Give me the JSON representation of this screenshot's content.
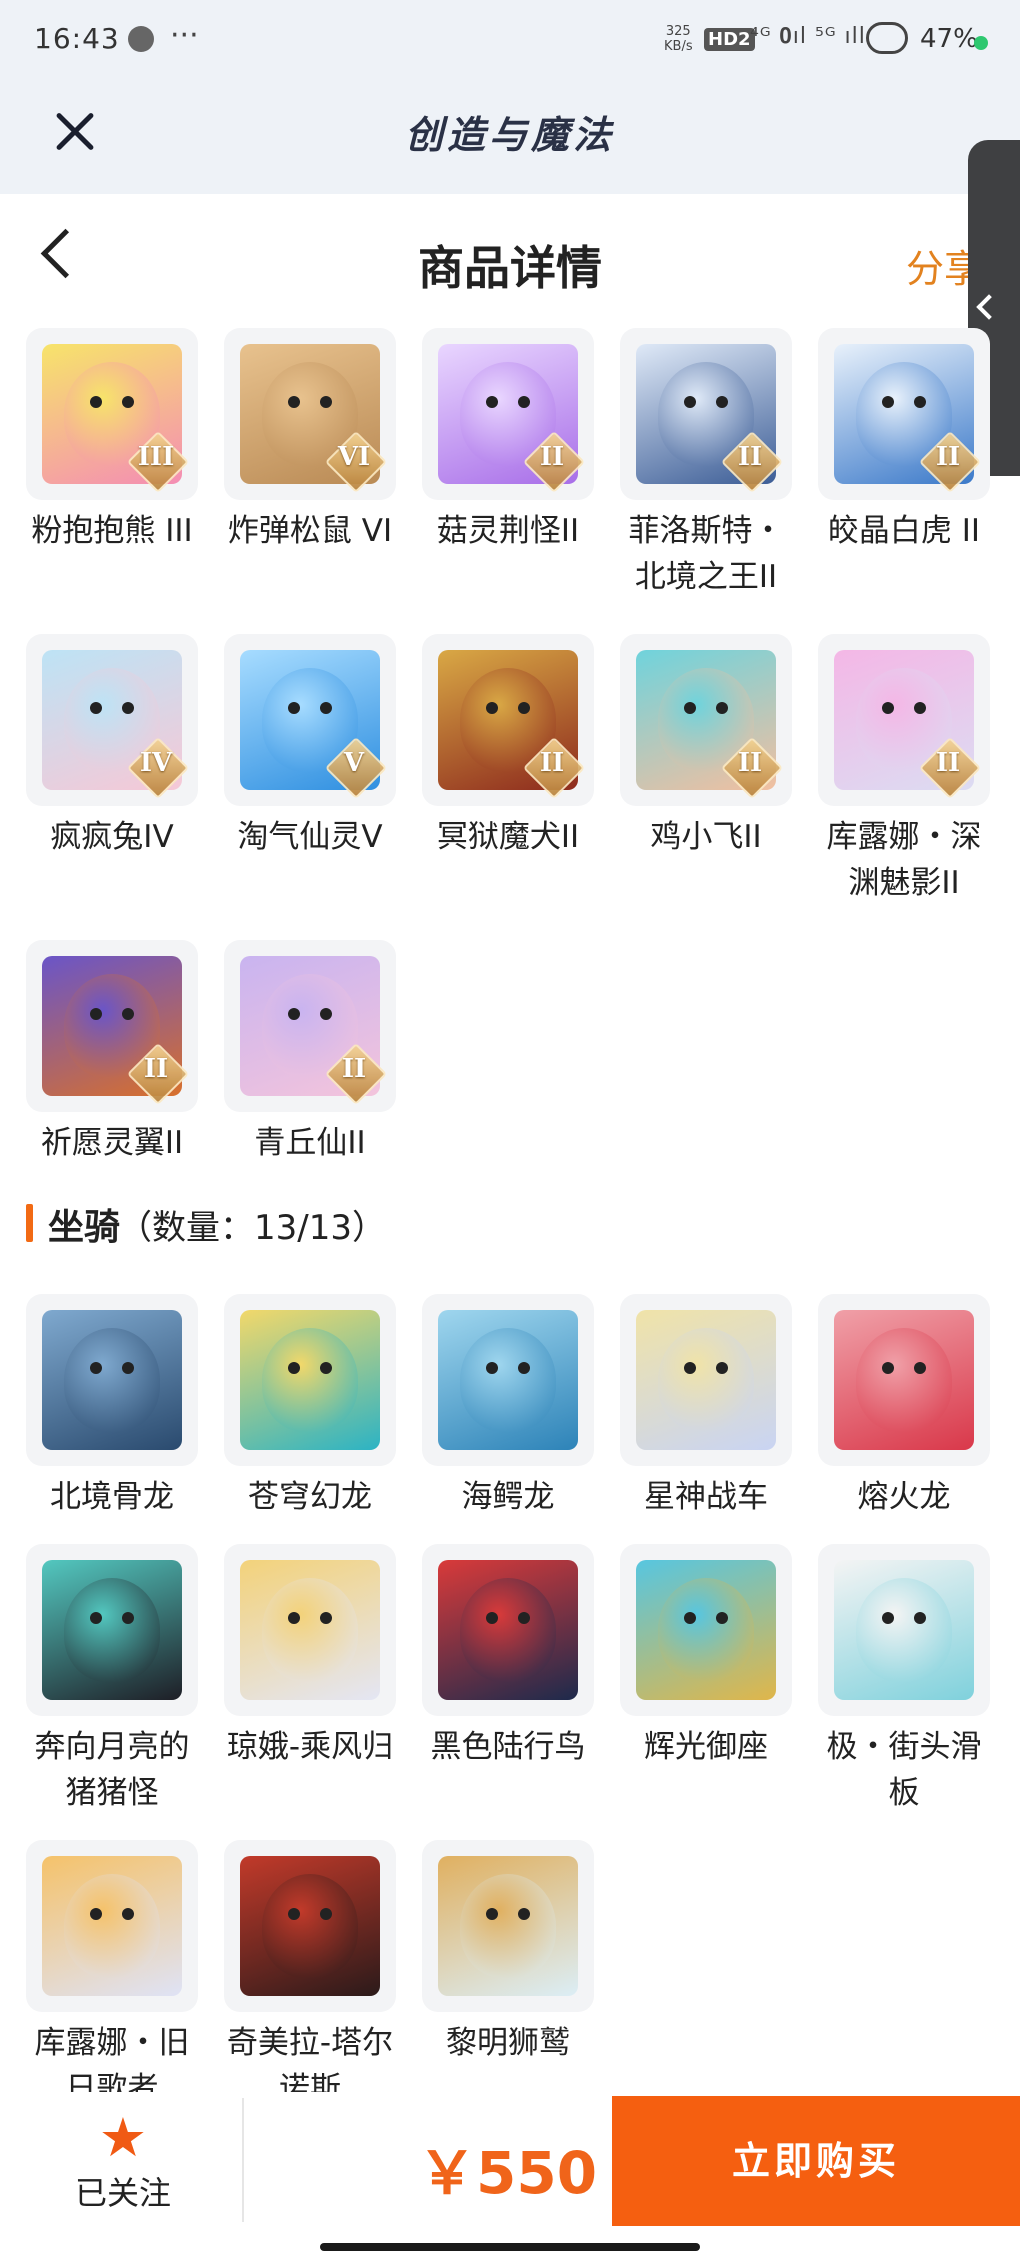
{
  "status_bar": {
    "time": "16:43",
    "more": "···",
    "speed_top": "325",
    "speed_bottom": "KB/s",
    "hd": "HD2",
    "signal": "⁴ᴳ 𝟎ıl ⁵ᴳ ıll",
    "battery": "47%"
  },
  "app": {
    "title": "创造与魔法"
  },
  "header": {
    "title": "商品详情",
    "share": "分享"
  },
  "pets": [
    {
      "name": "粉抱抱熊 III",
      "rank": "III",
      "c1": "#f48db4",
      "c2": "#f7e46a"
    },
    {
      "name": "炸弹松鼠 VI",
      "rank": "VI",
      "c1": "#b98a55",
      "c2": "#e8c28e"
    },
    {
      "name": "菇灵荆怪II",
      "rank": "II",
      "c1": "#a86ee8",
      "c2": "#e9d6ff"
    },
    {
      "name": "菲洛斯特・北境之王II",
      "rank": "II",
      "c1": "#3c5d96",
      "c2": "#dfe9f7"
    },
    {
      "name": "皎晶白虎 II",
      "rank": "II",
      "c1": "#3b79c9",
      "c2": "#e8f1fb"
    },
    {
      "name": "疯疯兔IV",
      "rank": "IV",
      "c1": "#f6c8d6",
      "c2": "#bde3f5"
    },
    {
      "name": "淘气仙灵V",
      "rank": "V",
      "c1": "#2f8fe0",
      "c2": "#a7dcff"
    },
    {
      "name": "冥狱魔犬II",
      "rank": "II",
      "c1": "#8d2a1d",
      "c2": "#d9a845"
    },
    {
      "name": "鸡小飞II",
      "rank": "II",
      "c1": "#f2bfa0",
      "c2": "#6fd3dc"
    },
    {
      "name": "库露娜・深渊魅影II",
      "rank": "II",
      "c1": "#dcdcf2",
      "c2": "#f4b7e6"
    },
    {
      "name": "祈愿灵翼II",
      "rank": "II",
      "c1": "#d8702c",
      "c2": "#6a55c8"
    },
    {
      "name": "青丘仙II",
      "rank": "II",
      "c1": "#f3c4dc",
      "c2": "#c9b4f0"
    }
  ],
  "mounts_section": {
    "title": "坐骑",
    "count": "（数量：13/13）"
  },
  "mounts": [
    {
      "name": "北境骨龙",
      "c1": "#2a4a6e",
      "c2": "#7fa9cf"
    },
    {
      "name": "苍穹幻龙",
      "c1": "#2cb3c4",
      "c2": "#f2d86a"
    },
    {
      "name": "海鳄龙",
      "c1": "#2d83b8",
      "c2": "#9fd6ee"
    },
    {
      "name": "星神战车",
      "c1": "#c9d4f3",
      "c2": "#f0e3a8"
    },
    {
      "name": "熔火龙",
      "c1": "#d9384a",
      "c2": "#f0a0a8"
    },
    {
      "name": "奔向月亮的猪猪怪",
      "c1": "#1e1e26",
      "c2": "#53c8c0"
    },
    {
      "name": "琼娥-乘风归",
      "c1": "#e4e6f4",
      "c2": "#f3d27a"
    },
    {
      "name": "黑色陆行鸟",
      "c1": "#1d2a4c",
      "c2": "#d93a3a"
    },
    {
      "name": "辉光御座",
      "c1": "#e0b64a",
      "c2": "#57c6e0"
    },
    {
      "name": "极・街头滑板",
      "c1": "#7fd1dc",
      "c2": "#f4f4f4"
    },
    {
      "name": "库露娜・旧日歌者",
      "c1": "#dfe3f6",
      "c2": "#f5c26a"
    },
    {
      "name": "奇美拉-塔尔诺斯",
      "c1": "#2b1a1a",
      "c2": "#c23a2a"
    },
    {
      "name": "黎明狮鹫",
      "c1": "#dceef6",
      "c2": "#e0b060"
    }
  ],
  "bottom_bar": {
    "follow_label": "已关注",
    "price": "￥550",
    "buy_label": "立即购买"
  },
  "colors": {
    "accent": "#f55f10",
    "price": "#f0641a",
    "share": "#e2821f"
  }
}
